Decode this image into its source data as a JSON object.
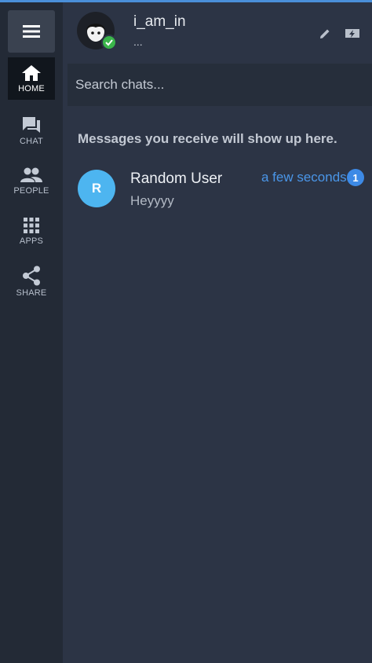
{
  "sidebar": {
    "menu_icon": "hamburger-menu-icon",
    "items": [
      {
        "label": "HOME",
        "icon": "home-icon",
        "active": true
      },
      {
        "label": "CHAT",
        "icon": "chat-bubbles-icon",
        "active": false
      },
      {
        "label": "PEOPLE",
        "icon": "people-icon",
        "active": false
      },
      {
        "label": "APPS",
        "icon": "apps-grid-icon",
        "active": false
      },
      {
        "label": "SHARE",
        "icon": "share-icon",
        "active": false
      }
    ]
  },
  "header": {
    "username": "i_am_in",
    "status_text": "...",
    "presence": "online",
    "actions": [
      "edit-icon",
      "flash-message-icon"
    ]
  },
  "search": {
    "placeholder": "Search chats..."
  },
  "main": {
    "empty_note": "Messages you receive will show up here.",
    "chats": [
      {
        "initial": "R",
        "name": "Random User",
        "preview": "Heyyyy",
        "time": "a few seconds",
        "unread": "1"
      }
    ]
  },
  "colors": {
    "accent": "#4a96e8",
    "rail_bg": "#232a36",
    "main_bg": "#2c3445",
    "online": "#3ab54a",
    "avatar_blue": "#4db5f0"
  }
}
